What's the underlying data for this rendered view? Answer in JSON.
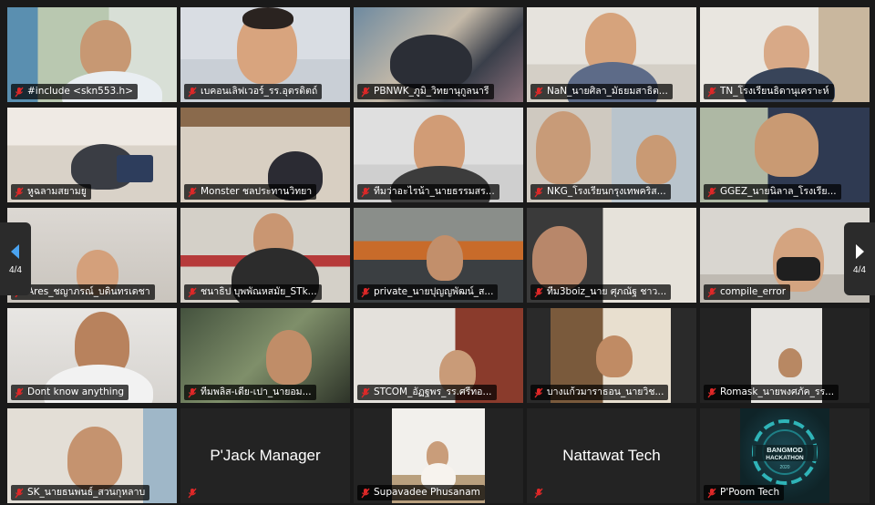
{
  "pager": {
    "left_label": "4/4",
    "right_label": "4/4"
  },
  "participants": [
    "#include <skn553.h>",
    "เบคอนเลิฟเวอร์_รร.อุตรดิตถ์",
    "PBNWK_ภูมิ_วิทยานุกูลนารี",
    "NaN_นายศิลา_มัธยมสาธิต...",
    "TN_โรงเรียนธิดานุเคราะห์",
    "หูฉลามสยามยู",
    "Monster ชลประทานวิทยา",
    "ทีมว่าอะไรน้า_นายธรรมสร...",
    "NKG_โรงเรียนกรุงเทพคริส...",
    "GGEZ_นายนิลาล_โรงเรีย...",
    "Ares_ชญาภรณ์_บดินทรเดชา",
    "ชนาธิป บุพพัณหสมัย_STk...",
    "private_นายปุญญพัฒน์_ส...",
    "ทีม3boiz_นาย ศุภณัฐ ชาว...",
    "compile_error",
    "Dont know anything",
    "ทีมพลิส-เดีย-เปา_นายอม...",
    "STCOM_อัฏฐพร_รร.ศรีทอ...",
    "บางแก้วมาราธอน_นายวิช...",
    "Romask_นายพงศภัค_รร...",
    "SK_นายธนพนธ์_สวนกุหลาบ",
    "P'Jack Manager",
    "Supavadee Phusanam",
    "Nattawat Tech",
    "P'Poom Tech"
  ],
  "logo_text": "BANGMOD HACKATHON 2020",
  "colors": {
    "mute_red": "#e02828",
    "tile_bg": "#232323",
    "page_bg": "#1a1a1a"
  }
}
